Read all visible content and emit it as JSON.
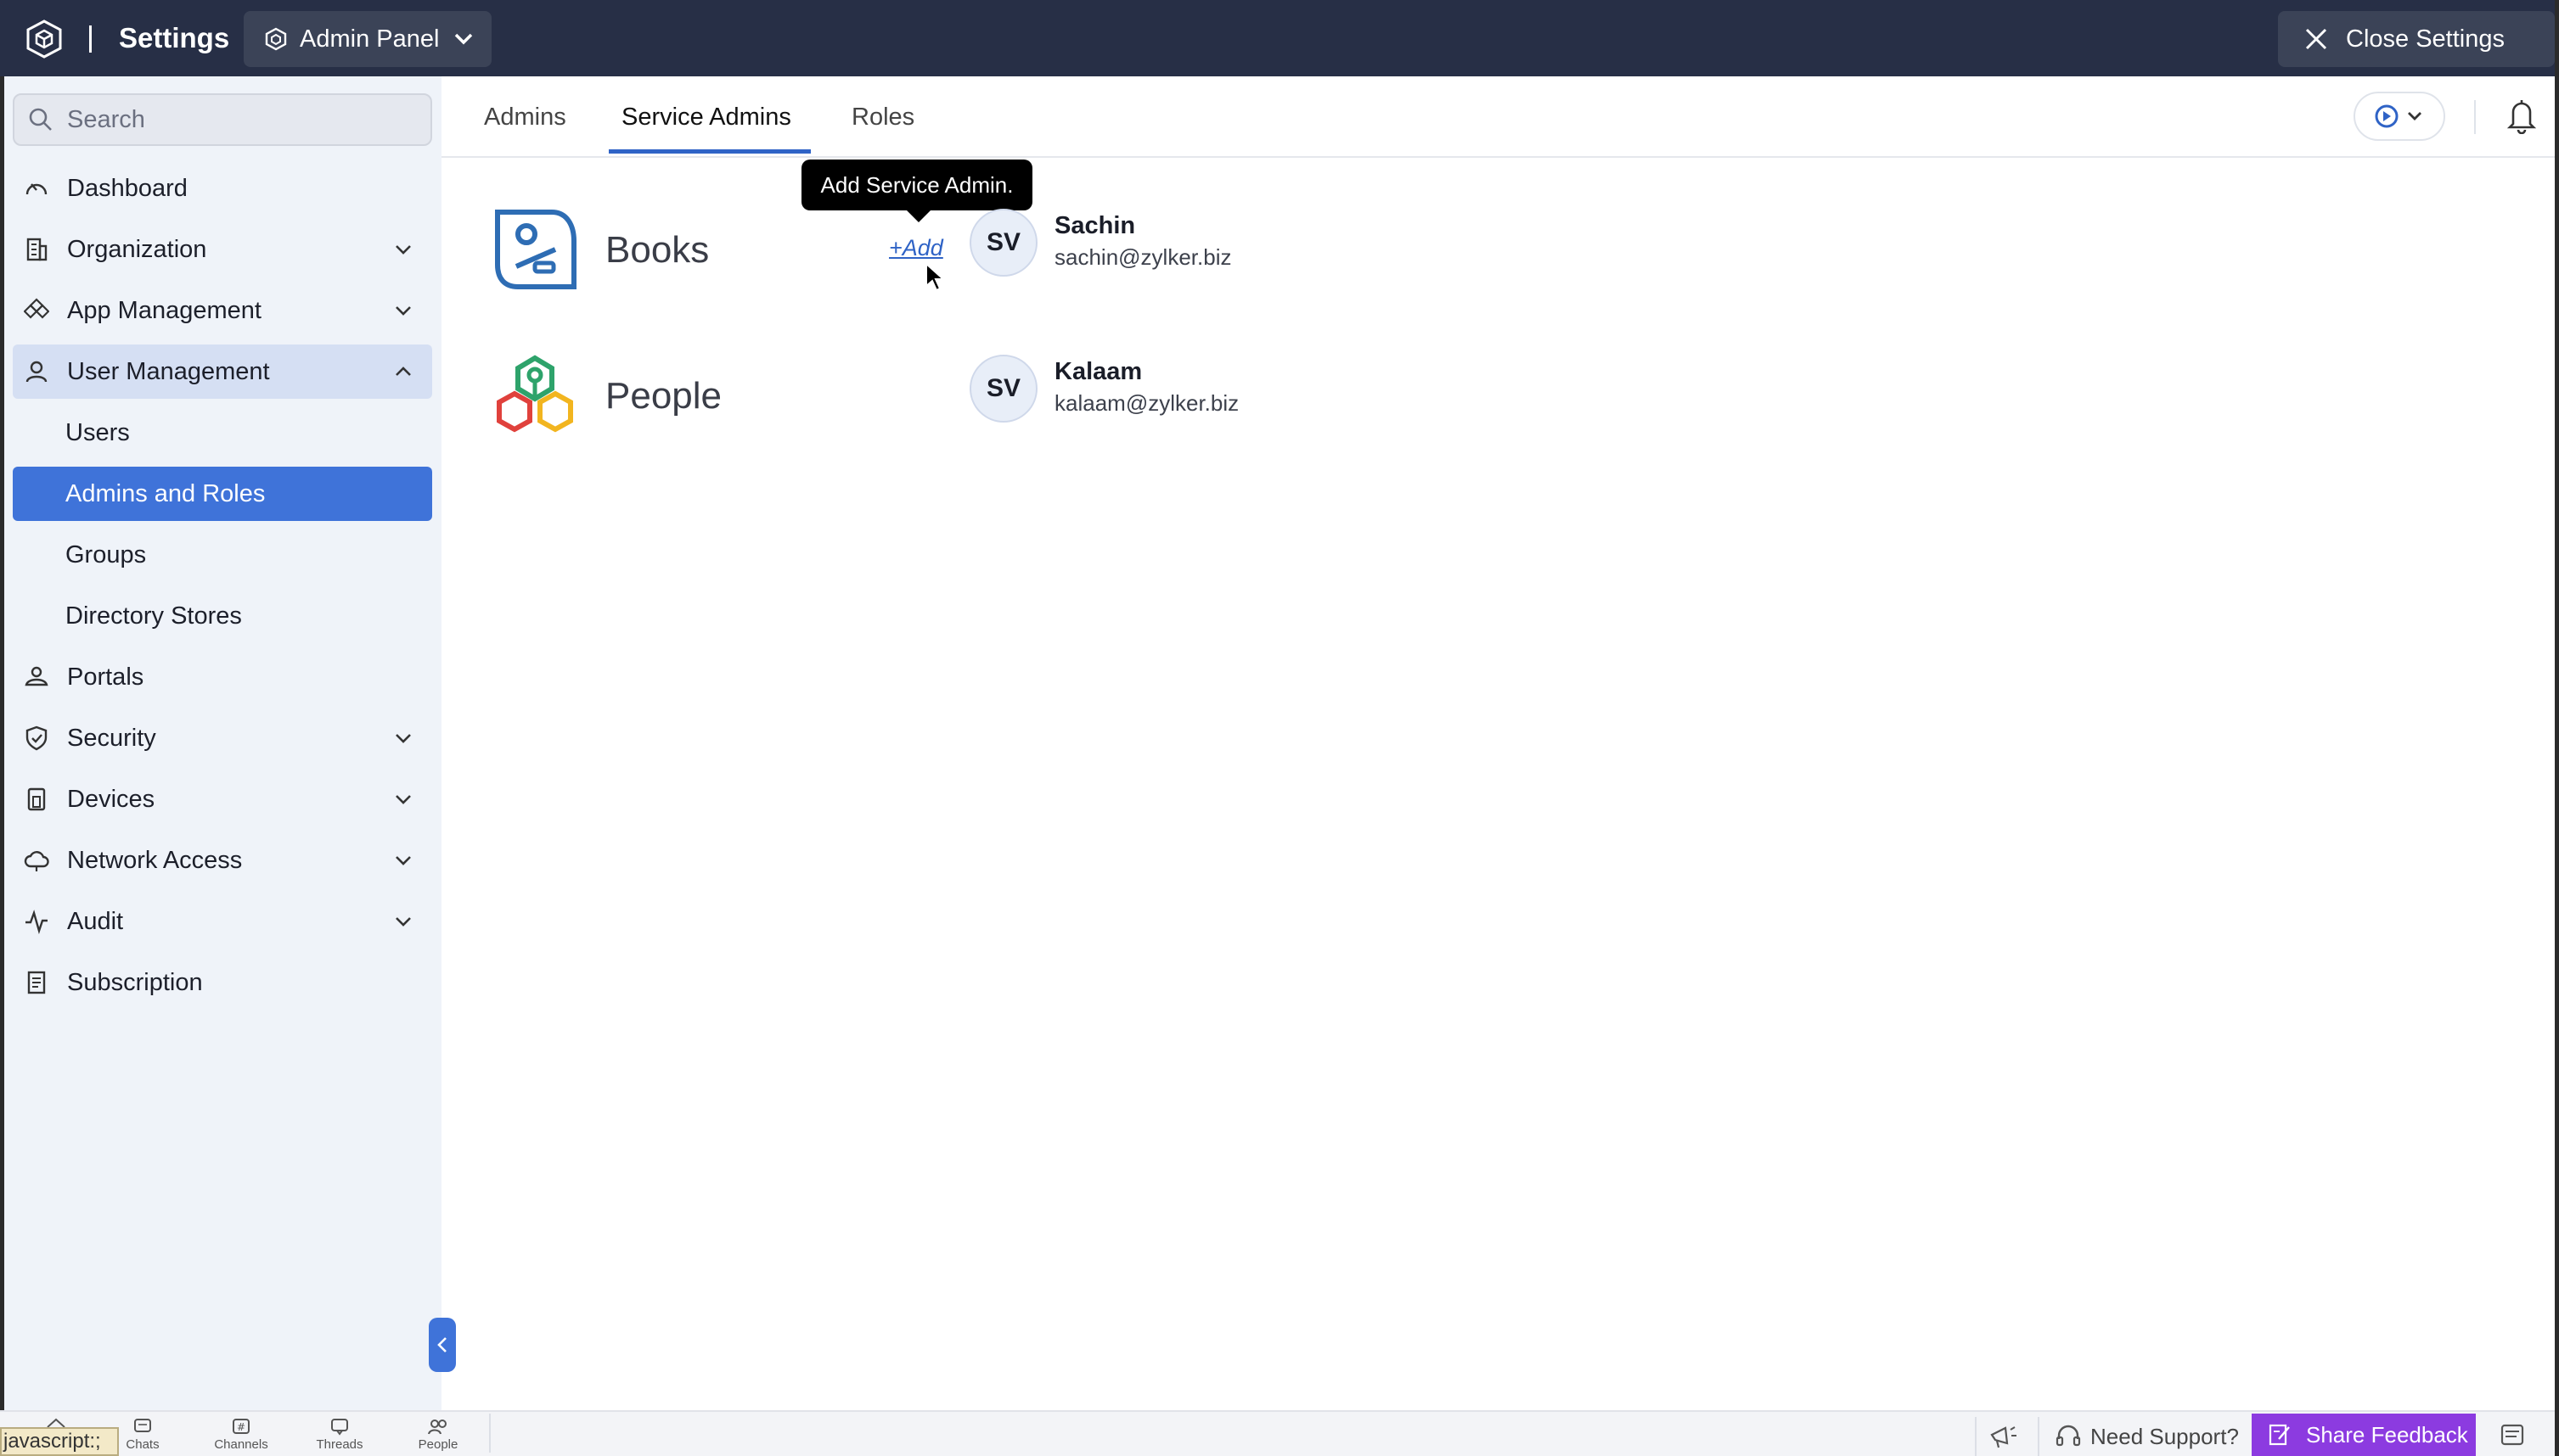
{
  "header": {
    "title": "Settings",
    "panel_selector": "Admin Panel",
    "close_label": "Close Settings"
  },
  "sidebar": {
    "search_placeholder": "Search",
    "items": [
      {
        "label": "Dashboard",
        "icon": "dashboard-gauge-icon"
      },
      {
        "label": "Organization",
        "icon": "building-icon",
        "caret": "chevron-down-icon"
      },
      {
        "label": "App Management",
        "icon": "apps-icon",
        "caret": "chevron-down-icon"
      },
      {
        "label": "User Management",
        "icon": "user-icon",
        "caret": "chevron-up-icon",
        "expanded": true
      },
      {
        "label": "Users"
      },
      {
        "label": "Admins and Roles",
        "active": true
      },
      {
        "label": "Groups"
      },
      {
        "label": "Directory Stores"
      },
      {
        "label": "Portals",
        "icon": "portal-user-icon"
      },
      {
        "label": "Security",
        "icon": "shield-icon",
        "caret": "chevron-down-icon"
      },
      {
        "label": "Devices",
        "icon": "devices-icon",
        "caret": "chevron-down-icon"
      },
      {
        "label": "Network Access",
        "icon": "cloud-icon",
        "caret": "chevron-down-icon"
      },
      {
        "label": "Audit",
        "icon": "pulse-icon",
        "caret": "chevron-down-icon"
      },
      {
        "label": "Subscription",
        "icon": "receipt-icon"
      }
    ]
  },
  "tabs": [
    {
      "label": "Admins"
    },
    {
      "label": "Service Admins",
      "active": true
    },
    {
      "label": "Roles"
    }
  ],
  "tooltip": "Add Service Admin.",
  "add_link": "+Add",
  "services": [
    {
      "name": "Books",
      "logo": "books-logo",
      "admin": {
        "initials": "SV",
        "name": "Sachin",
        "email": "sachin@zylker.biz"
      }
    },
    {
      "name": "People",
      "logo": "people-logo",
      "admin": {
        "initials": "SV",
        "name": "Kalaam",
        "email": "kalaam@zylker.biz"
      }
    }
  ],
  "bottombar": {
    "status_text": "javascript:;",
    "apps": [
      "Chats",
      "Channels",
      "Threads",
      "People"
    ],
    "need_support": "Need Support?",
    "share_feedback": "Share Feedback"
  },
  "colors": {
    "topbar": "#272f46",
    "accent": "#3f73d9",
    "feedback": "#8c3be0"
  }
}
